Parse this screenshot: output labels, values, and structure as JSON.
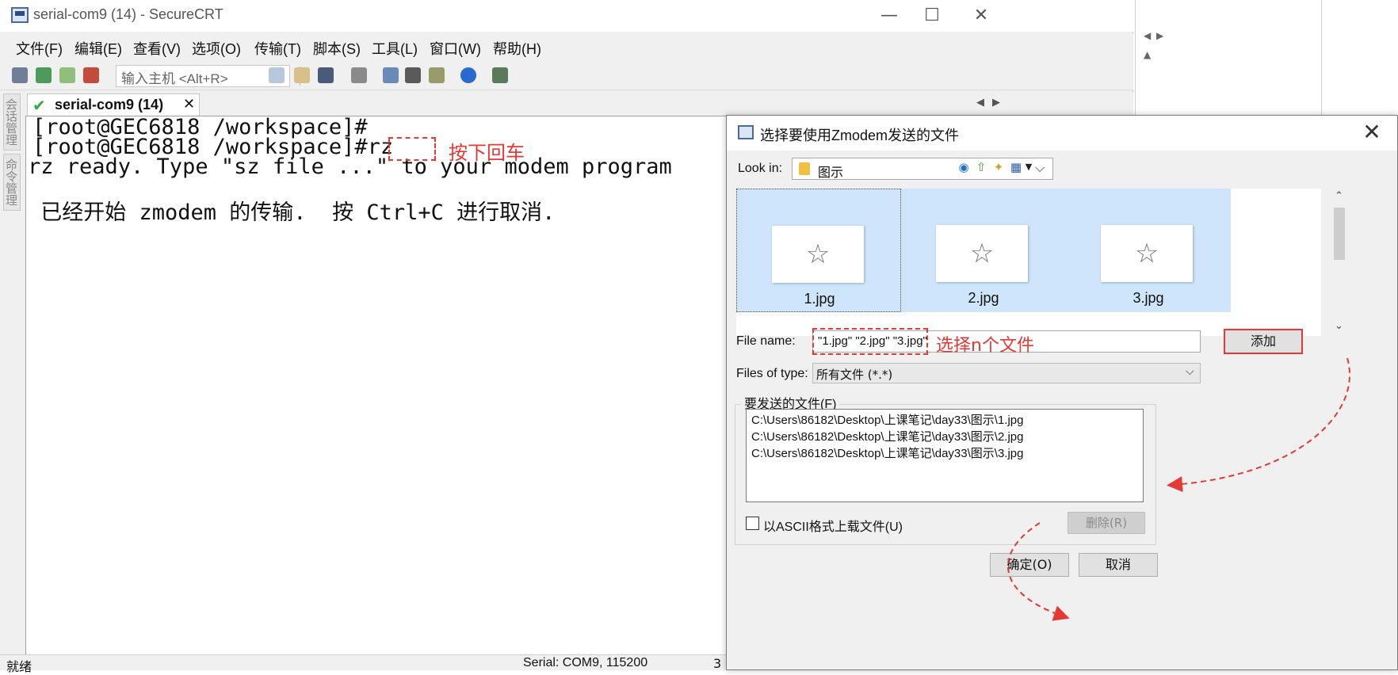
{
  "window": {
    "title": "serial-com9 (14) - SecureCRT",
    "controls": {
      "minimize": "—",
      "maximize": "☐",
      "close": "✕"
    }
  },
  "menu": [
    "文件(F)",
    "编辑(E)",
    "查看(V)",
    "选项(O)",
    "传输(T)",
    "脚本(S)",
    "工具(L)",
    "窗口(W)",
    "帮助(H)"
  ],
  "toolbar": {
    "host_placeholder": "输入主机 <Alt+R>"
  },
  "sidebar": {
    "tabs": [
      "会话管理",
      "命令管理"
    ]
  },
  "tab": {
    "label": "serial-com9 (14)",
    "close": "✕"
  },
  "terminal": {
    "lines": [
      "[root@GEC6818 /workspace]#",
      "[root@GEC6818 /workspace]#rz",
      "rz ready. Type \"sz file ...\" to your modem program",
      " 已经开始 zmodem 的传输.  按 Ctrl+C 进行取消."
    ],
    "annotation": "按下回车"
  },
  "status": {
    "ready": "就绪",
    "port": "Serial: COM9, 115200",
    "num": "3"
  },
  "dialog": {
    "title": "选择要使用Zmodem发送的文件",
    "close": "✕",
    "look_in_label": "Look in:",
    "look_in_value": "图示",
    "files": [
      "1.jpg",
      "2.jpg",
      "3.jpg"
    ],
    "file_name_label": "File name:",
    "file_name_value": "\"1.jpg\" \"2.jpg\" \"3.jpg\"",
    "file_name_annotation": "选择n个文件",
    "add_button": "添加",
    "files_of_type_label": "Files of type:",
    "files_of_type_value": "所有文件 (*.*)",
    "send_group_label": "要发送的文件(F)",
    "send_list": [
      "C:\\Users\\86182\\Desktop\\上课笔记\\day33\\图示\\1.jpg",
      "C:\\Users\\86182\\Desktop\\上课笔记\\day33\\图示\\2.jpg",
      "C:\\Users\\86182\\Desktop\\上课笔记\\day33\\图示\\3.jpg"
    ],
    "ascii_label": "以ASCII格式上载文件(U)",
    "ascii_checked": false,
    "delete_button": "删除(R)",
    "ok_button": "确定(O)",
    "cancel_button": "取消"
  },
  "colors": {
    "annotation_red": "#e53935",
    "selection_blue": "#cfe5fb"
  }
}
